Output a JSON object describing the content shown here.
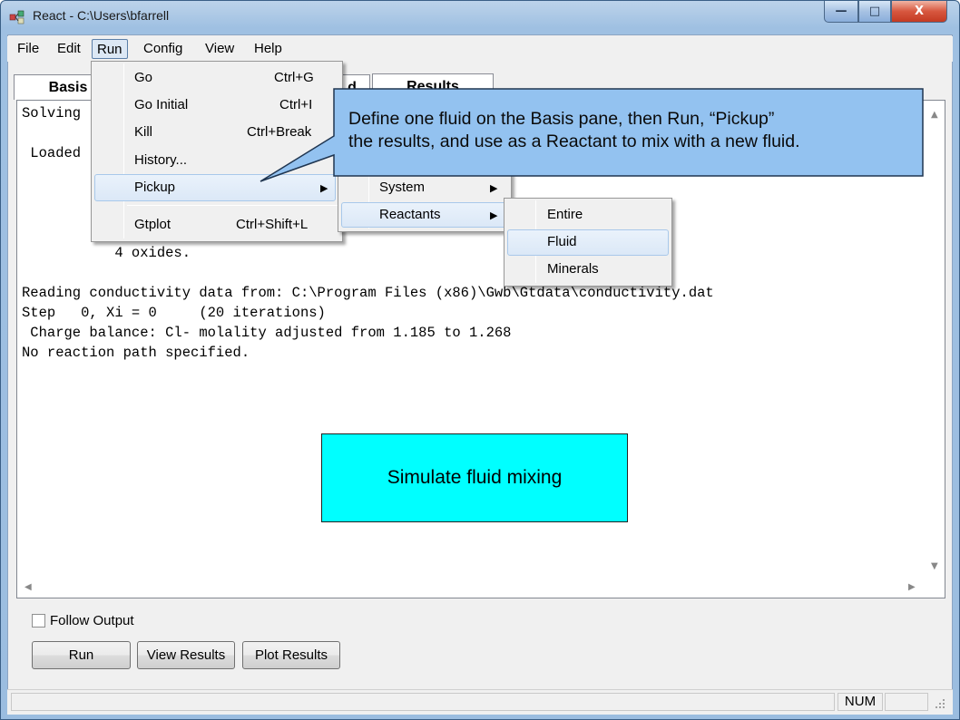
{
  "window": {
    "title": "React - C:\\Users\\bfarrell",
    "min_glyph": "—",
    "max_glyph": "□",
    "close_glyph": "X"
  },
  "menubar": [
    "File",
    "Edit",
    "Run",
    "Config",
    "View",
    "Help"
  ],
  "tabs": {
    "basis": "Basis",
    "hidden": "d",
    "results": "Results"
  },
  "output": {
    "lines_partial": [
      "Solving",
      "",
      " Loaded"
    ],
    "oxides_line": "           4 oxides.",
    "lines": [
      "Reading conductivity data from: C:\\Program Files (x86)\\Gwb\\Gtdata\\conductivity.dat",
      "Step   0, Xi = 0     (20 iterations)",
      " Charge balance: Cl- molality adjusted from 1.185 to 1.268",
      "No reaction path specified."
    ]
  },
  "run_menu": [
    {
      "label": "Go",
      "shortcut": "Ctrl+G"
    },
    {
      "label": "Go Initial",
      "shortcut": "Ctrl+I"
    },
    {
      "label": "Kill",
      "shortcut": "Ctrl+Break"
    },
    {
      "label": "History...",
      "shortcut": ""
    },
    {
      "label": "Pickup",
      "shortcut": "▶"
    },
    {
      "label": "Gtplot",
      "shortcut": "Ctrl+Shift+L"
    }
  ],
  "pickup_submenu": [
    {
      "label": "System",
      "arrow": "▶"
    },
    {
      "label": "Reactants",
      "arrow": "▶"
    }
  ],
  "reactants_submenu": [
    "Entire",
    "Fluid",
    "Minerals"
  ],
  "callout": {
    "text_line1": "Define one fluid on the Basis pane, then Run, “Pickup”",
    "text_line2": "the results, and use as a Reactant to mix with a new fluid.",
    "fill": "#93c2f0"
  },
  "simulate_box": {
    "text": "Simulate fluid mixing",
    "fill": "#00ffff"
  },
  "controls": {
    "follow_output": "Follow Output",
    "follow_checked": false,
    "run": "Run",
    "view_results": "View Results",
    "plot_results": "Plot Results"
  },
  "status": {
    "num": "NUM"
  }
}
